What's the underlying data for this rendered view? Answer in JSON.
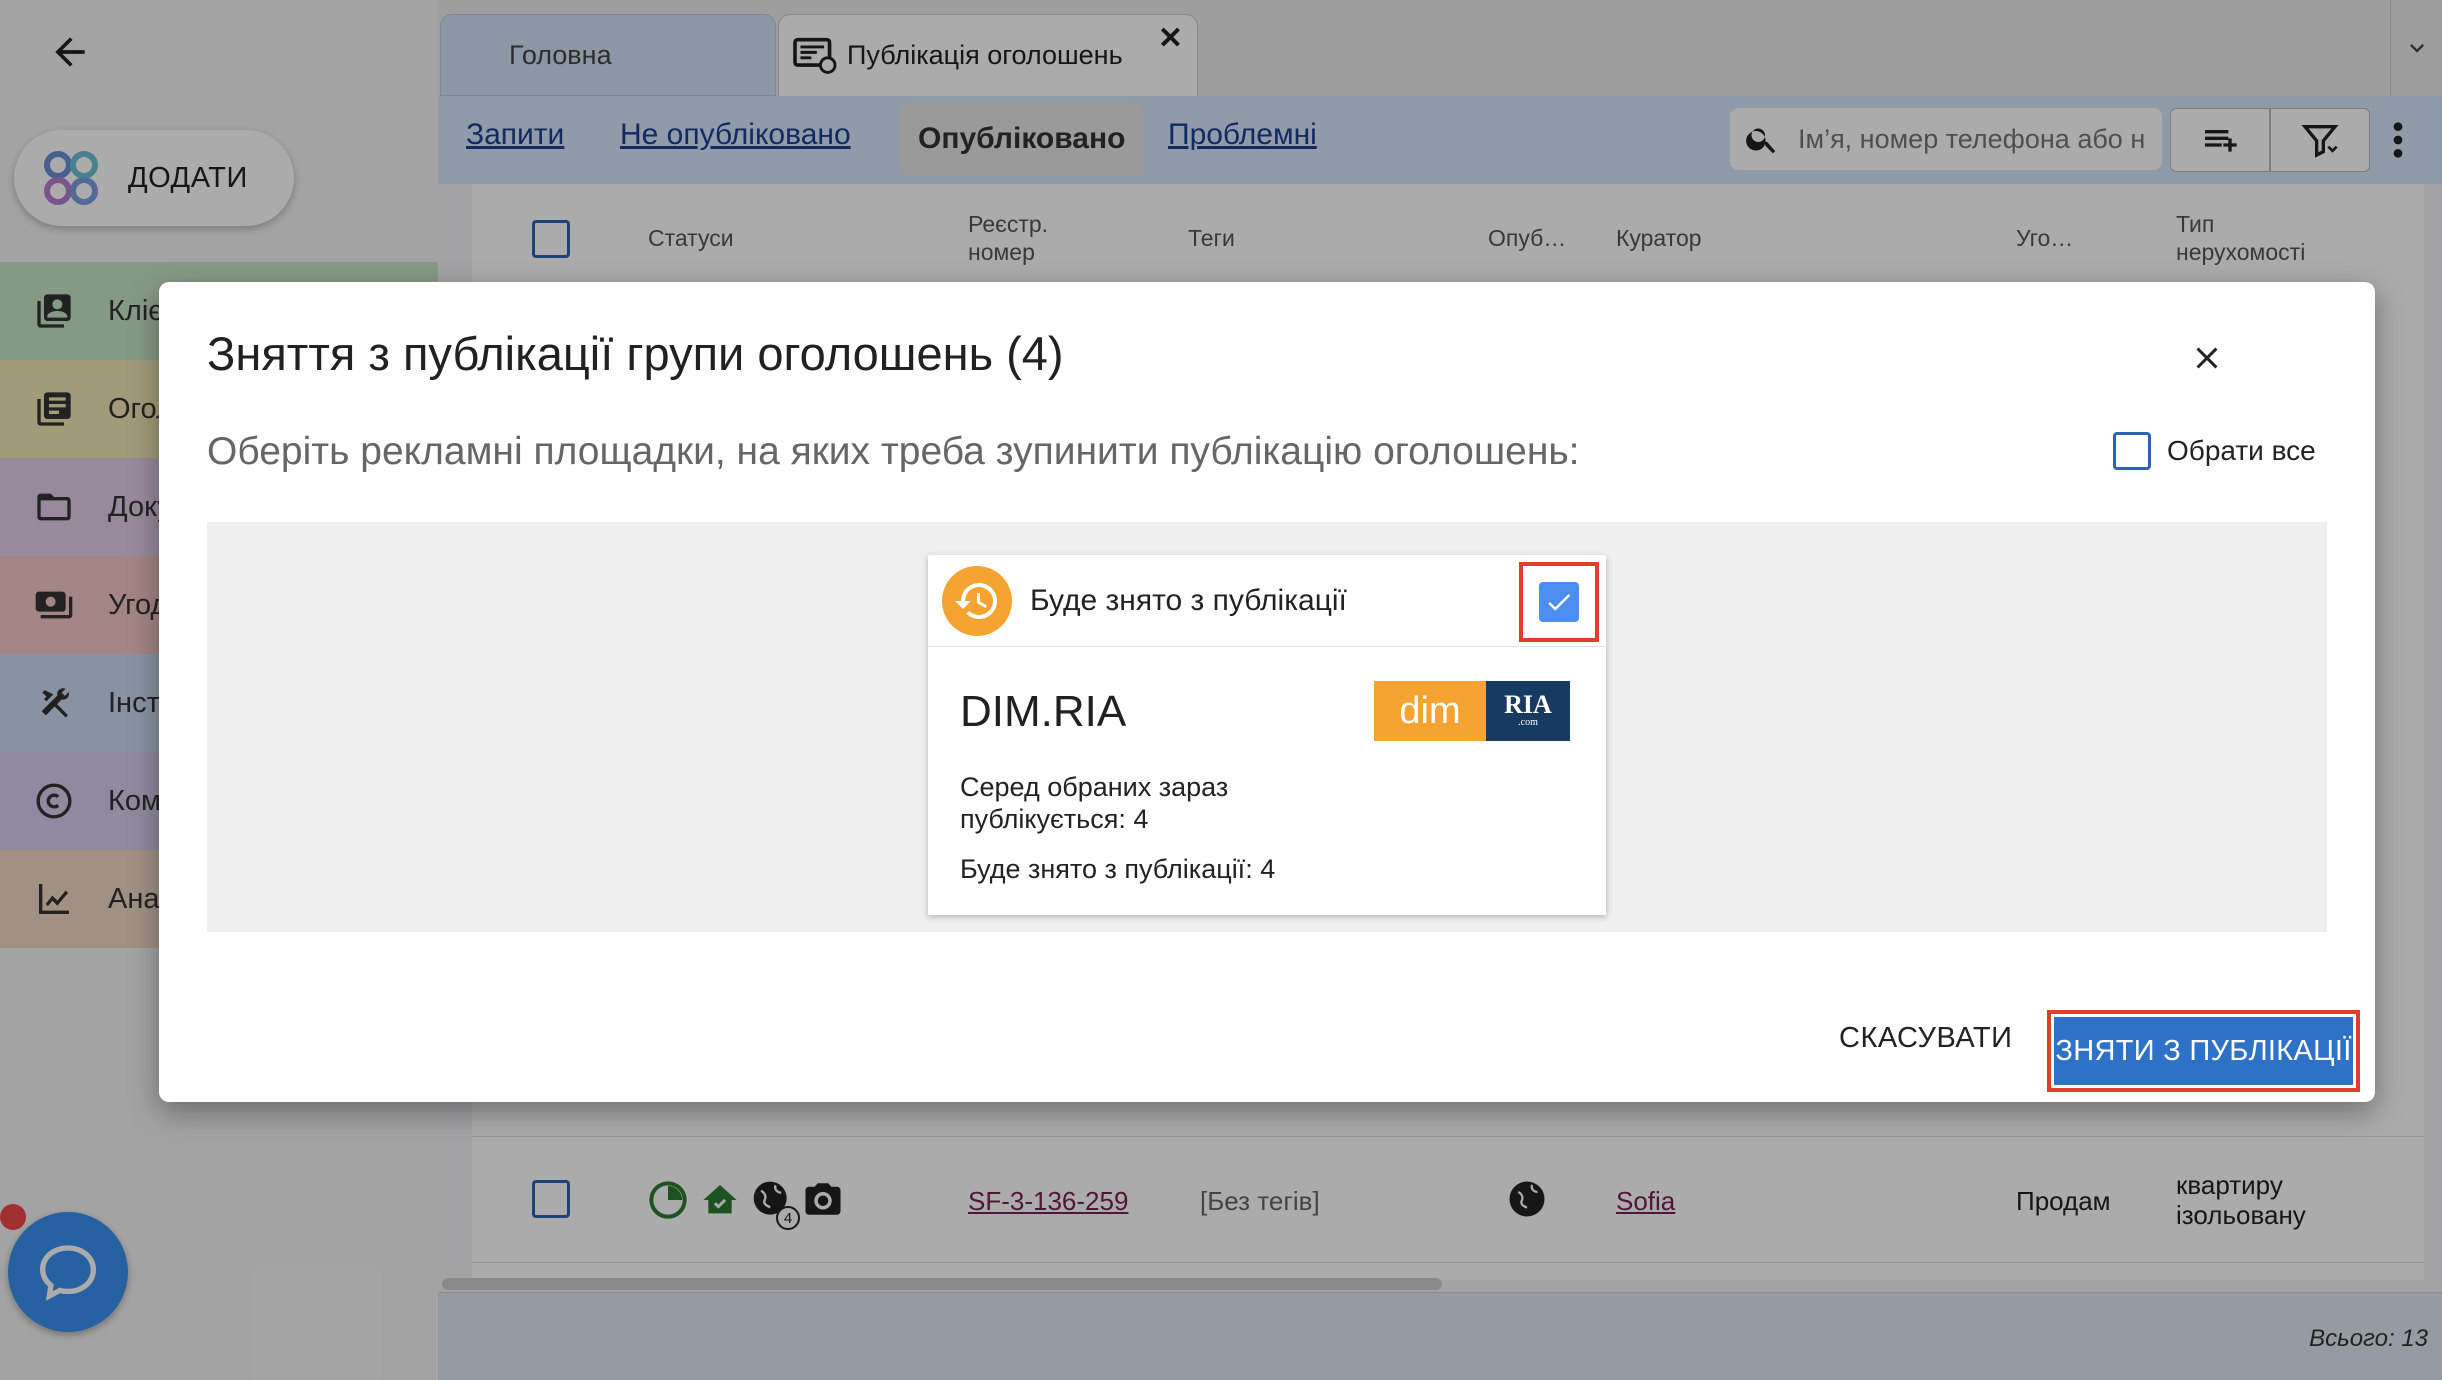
{
  "sidebar": {
    "add_label": "ДОДАТИ",
    "items": [
      {
        "label": "Клієнти",
        "icon": "contacts-icon",
        "color": "#c6e6c6"
      },
      {
        "label": "Оголошення",
        "icon": "listings-icon",
        "color": "#f1e7b5"
      },
      {
        "label": "Документи",
        "icon": "folder-icon",
        "color": "#e4cdea"
      },
      {
        "label": "Угоди",
        "icon": "deal-icon",
        "color": "#f3c7c3"
      },
      {
        "label": "Інструменти",
        "icon": "tools-icon",
        "color": "#c9dcf3"
      },
      {
        "label": "Комісії",
        "icon": "copyright-icon",
        "color": "#d9cdee"
      },
      {
        "label": "Аналітика",
        "icon": "analytics-icon",
        "color": "#f1d8c4"
      }
    ]
  },
  "tabs": {
    "home": "Головна",
    "active": "Публікація оголошень"
  },
  "filters": {
    "requests": "Запити",
    "unpublished": "Не опубліковано",
    "published": "Опубліковано",
    "problematic": "Проблемні",
    "search_placeholder": "Ім’я, номер телефона або н"
  },
  "table": {
    "headers": {
      "statuses": "Статуси",
      "reg_number_1": "Реєстр.",
      "reg_number_2": "номер",
      "tags": "Теги",
      "published": "Опуб…",
      "curator": "Куратор",
      "deal": "Уго…",
      "property_type_1": "Тип",
      "property_type_2": "нерухомості"
    },
    "row": {
      "reg_number": "SF-3-136-259",
      "tags": "[Без тегів]",
      "curator": "Sofia",
      "deal": "Продам",
      "property_type_1": "квартиру",
      "property_type_2": "ізольовану",
      "globe_badge": "4"
    },
    "total": "Всього: 13"
  },
  "dialog": {
    "title": "Зняття з публікації групи оголошень (4)",
    "subtitle": "Оберіть рекламні площадки, на яких треба зупинити публікацію оголошень:",
    "select_all": "Обрати все",
    "card": {
      "status_label": "Буде знято з публікації",
      "checked": true,
      "platform": "DIM.RIA",
      "logo_left": "dim",
      "logo_right": "RIA",
      "logo_sub": ".com",
      "line1": "Серед обраних зараз",
      "line2": "публікується: 4",
      "line3": "Буде знято з публікації: 4"
    },
    "cancel": "СКАСУВАТИ",
    "confirm": "ЗНЯТИ З ПУБЛІКАЦІЇ"
  },
  "colors": {
    "accent": "#2e72c8",
    "highlight": "#e23c2a",
    "status_orange": "#f5a431",
    "checkbox_blue": "#4c8df2"
  }
}
